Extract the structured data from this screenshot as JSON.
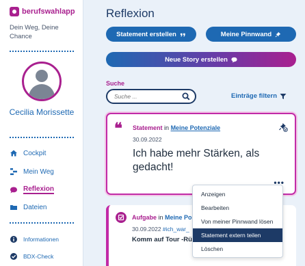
{
  "brand": {
    "name": "berufswahlapp",
    "tagline": "Dein Weg, Deine Chance"
  },
  "user": {
    "name": "Cecilia Morissette"
  },
  "nav": {
    "items": [
      {
        "label": "Cockpit",
        "icon": "home-icon"
      },
      {
        "label": "Mein Weg",
        "icon": "path-icon"
      },
      {
        "label": "Reflexion",
        "icon": "reflection-icon",
        "active": true
      },
      {
        "label": "Dateien",
        "icon": "folder-icon"
      }
    ],
    "secondary": [
      {
        "label": "Informationen",
        "icon": "info-icon"
      },
      {
        "label": "BDX-Check",
        "icon": "check-icon"
      }
    ]
  },
  "page": {
    "title": "Reflexion"
  },
  "actions": {
    "create_statement": "Statement erstellen",
    "pinboard": "Meine Pinnwand",
    "new_story": "Neue Story erstellen"
  },
  "search": {
    "label": "Suche",
    "placeholder": "Suche ..."
  },
  "filter": {
    "label": "Einträge filtern"
  },
  "statement_card": {
    "type": "Statement",
    "connector": "in",
    "context": "Meine Potenziale",
    "date": "30.09.2022",
    "text": "Ich habe mehr Stärken, als gedacht!"
  },
  "task_card": {
    "type": "Aufgabe",
    "connector": "in",
    "context": "Meine Po",
    "date": "30.09.2022",
    "tag": "#ich_war_",
    "title": "Komm auf Tour -Rüc"
  },
  "context_menu": {
    "items": [
      "Anzeigen",
      "Bearbeiten",
      "Von meiner Pinnwand lösen",
      "Statement extern teilen",
      "Löschen"
    ],
    "active_index": 3
  },
  "colors": {
    "primary": "#1e69b3",
    "accent": "#a9208f",
    "dark": "#1d3a66",
    "background": "#eaf1f9"
  }
}
